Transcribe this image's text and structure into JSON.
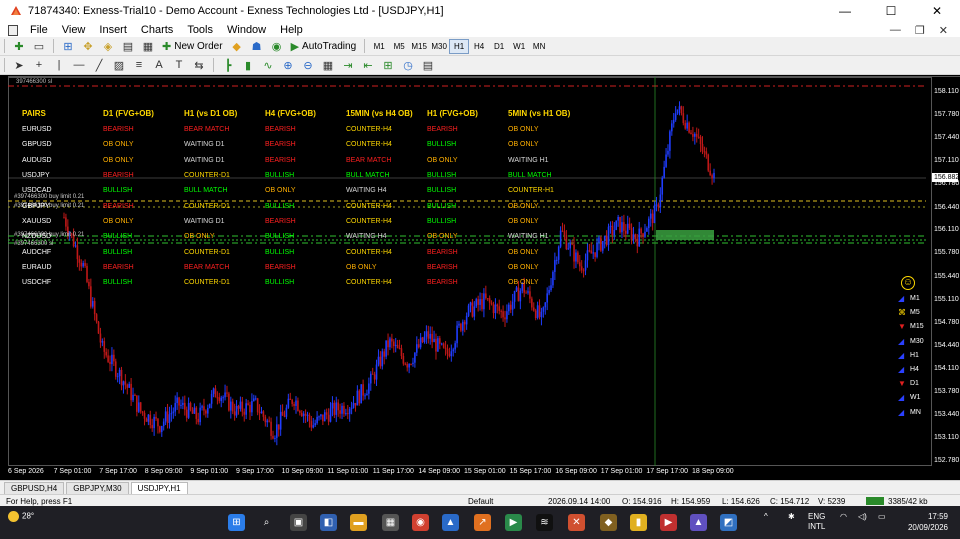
{
  "window": {
    "title": "71874340: Exness-Trial10 - Demo Account - Exness Technologies Ltd - [USDJPY,H1]",
    "minimize": "—",
    "maximize": "☐",
    "close": "✕"
  },
  "menu": [
    "File",
    "View",
    "Insert",
    "Charts",
    "Tools",
    "Window",
    "Help"
  ],
  "mdi_controls": [
    "—",
    "❐",
    "✕"
  ],
  "toolbar": {
    "new_order": "New Order",
    "auto_trading": "AutoTrading",
    "timeframes": [
      "M1",
      "M5",
      "M15",
      "M30",
      "H1",
      "H4",
      "D1",
      "W1",
      "MN"
    ],
    "active_timeframe": "H1"
  },
  "chart": {
    "id_label": "397466300 sl",
    "scanner": {
      "headers": [
        "PAIRS",
        "D1 (FVG+OB)",
        "H1 (vs D1 OB)",
        "H4 (FVG+OB)",
        "15MIN (vs H4 OB)",
        "H1 (FVG+OB)",
        "5MIN (vs H1 OB)"
      ],
      "rows": [
        {
          "pair": "EURUSD",
          "cells": [
            "BEARISH",
            "BEAR MATCH",
            "BEARISH",
            "COUNTER-H4",
            "BEARISH",
            "OB ONLY"
          ]
        },
        {
          "pair": "GBPUSD",
          "cells": [
            "OB ONLY",
            "WAITING D1",
            "BEARISH",
            "COUNTER-H4",
            "BULLISH",
            "OB ONLY"
          ]
        },
        {
          "pair": "AUDUSD",
          "cells": [
            "OB ONLY",
            "WAITING D1",
            "BEARISH",
            "BEAR MATCH",
            "OB ONLY",
            "WAITING H1"
          ]
        },
        {
          "pair": "USDJPY",
          "cells": [
            "BEARISH",
            "COUNTER-D1",
            "BULLISH",
            "BULL MATCH",
            "BULLISH",
            "BULL MATCH"
          ]
        },
        {
          "pair": "USDCAD",
          "cells": [
            "BULLISH",
            "BULL MATCH",
            "OB ONLY",
            "WAITING H4",
            "BULLISH",
            "COUNTER-H1"
          ]
        },
        {
          "pair": "GBPJPY",
          "cells": [
            "BEARISH",
            "COUNTER-D1",
            "BULLISH",
            "COUNTER-H4",
            "BULLISH",
            "OB ONLY"
          ]
        },
        {
          "pair": "XAUUSD",
          "cells": [
            "OB ONLY",
            "WAITING D1",
            "BEARISH",
            "COUNTER-H4",
            "BULLISH",
            "OB ONLY"
          ]
        },
        {
          "pair": "NZDUSD",
          "cells": [
            "BULLISH",
            "OB ONLY",
            "BULLISH",
            "WAITING H4",
            "OB ONLY",
            "WAITING H1"
          ]
        },
        {
          "pair": "AUDCHF",
          "cells": [
            "BULLISH",
            "COUNTER-D1",
            "BULLISH",
            "COUNTER-H4",
            "BEARISH",
            "OB ONLY"
          ]
        },
        {
          "pair": "EURAUD",
          "cells": [
            "BEARISH",
            "BEAR MATCH",
            "BEARISH",
            "OB ONLY",
            "BEARISH",
            "OB ONLY"
          ]
        },
        {
          "pair": "USDCHF",
          "cells": [
            "BULLISH",
            "COUNTER-D1",
            "BULLISH",
            "COUNTER-H4",
            "BEARISH",
            "OB ONLY"
          ]
        }
      ]
    },
    "order_labels": [
      "#397466300 buy limit 0.21",
      "#397466300 buy limit 0.21",
      "#397466300 buy limit 0.21",
      "#397466300 sl"
    ],
    "timeframe_panel": [
      {
        "label": "M1",
        "dir": "up"
      },
      {
        "label": "M5",
        "dir": "neutral"
      },
      {
        "label": "M15",
        "dir": "down"
      },
      {
        "label": "M30",
        "dir": "up"
      },
      {
        "label": "H1",
        "dir": "up"
      },
      {
        "label": "H4",
        "dir": "up"
      },
      {
        "label": "D1",
        "dir": "down"
      },
      {
        "label": "W1",
        "dir": "up"
      },
      {
        "label": "MN",
        "dir": "up"
      }
    ],
    "current_price": "156.882",
    "colors": {
      "bullish": "#00ff00",
      "bearish": "#ff2020",
      "neutral_ob": "#ffb000",
      "waiting": "#d8d8d8",
      "header": "#ffd800",
      "candle_up": "#1f3dff",
      "candle_down": "#c01818"
    }
  },
  "chart_data": {
    "type": "candlestick",
    "symbol": "USDJPY",
    "timeframe": "H1",
    "y_ticks": [
      "158.110",
      "157.780",
      "157.440",
      "157.110",
      "156.780",
      "156.440",
      "156.110",
      "155.780",
      "155.440",
      "155.110",
      "154.780",
      "154.440",
      "154.110",
      "153.780",
      "153.440",
      "153.110",
      "152.780"
    ],
    "ylim": [
      152.78,
      158.11
    ],
    "x_ticks": [
      "6 Sep 2026",
      "7 Sep 01:00",
      "7 Sep 17:00",
      "8 Sep 09:00",
      "9 Sep 01:00",
      "9 Sep 17:00",
      "10 Sep 09:00",
      "11 Sep 01:00",
      "11 Sep 17:00",
      "14 Sep 09:00",
      "15 Sep 01:00",
      "15 Sep 17:00",
      "16 Sep 09:00",
      "17 Sep 01:00",
      "17 Sep 17:00",
      "18 Sep 09:00"
    ],
    "approx_close_path": [
      156.3,
      155.6,
      154.4,
      154.0,
      153.5,
      153.3,
      153.6,
      153.4,
      153.8,
      153.5,
      153.6,
      153.2,
      153.7,
      153.3,
      153.5,
      153.6,
      153.9,
      154.5,
      154.2,
      154.6,
      154.3,
      154.9,
      155.1,
      154.9,
      155.3,
      154.8,
      156.1,
      155.6,
      155.9,
      156.2,
      156.0,
      156.4,
      157.9,
      157.5,
      156.9
    ]
  },
  "tabs": [
    "GBPUSD,H4",
    "GBPJPY,M30",
    "USDJPY,H1"
  ],
  "active_tab": "USDJPY,H1",
  "status": {
    "help": "For Help, press F1",
    "profile": "Default",
    "datetime": "2026.09.14 14:00",
    "open": "O: 154.916",
    "high": "H: 154.959",
    "low": "L: 154.626",
    "close": "C: 154.712",
    "volume": "V: 5239",
    "traffic": "3385/42 kb"
  },
  "taskbar": {
    "weather": "28°",
    "lang": "ENG",
    "layout": "INTL",
    "time": "17:59",
    "date": "20/09/2026",
    "chevron": "^"
  }
}
